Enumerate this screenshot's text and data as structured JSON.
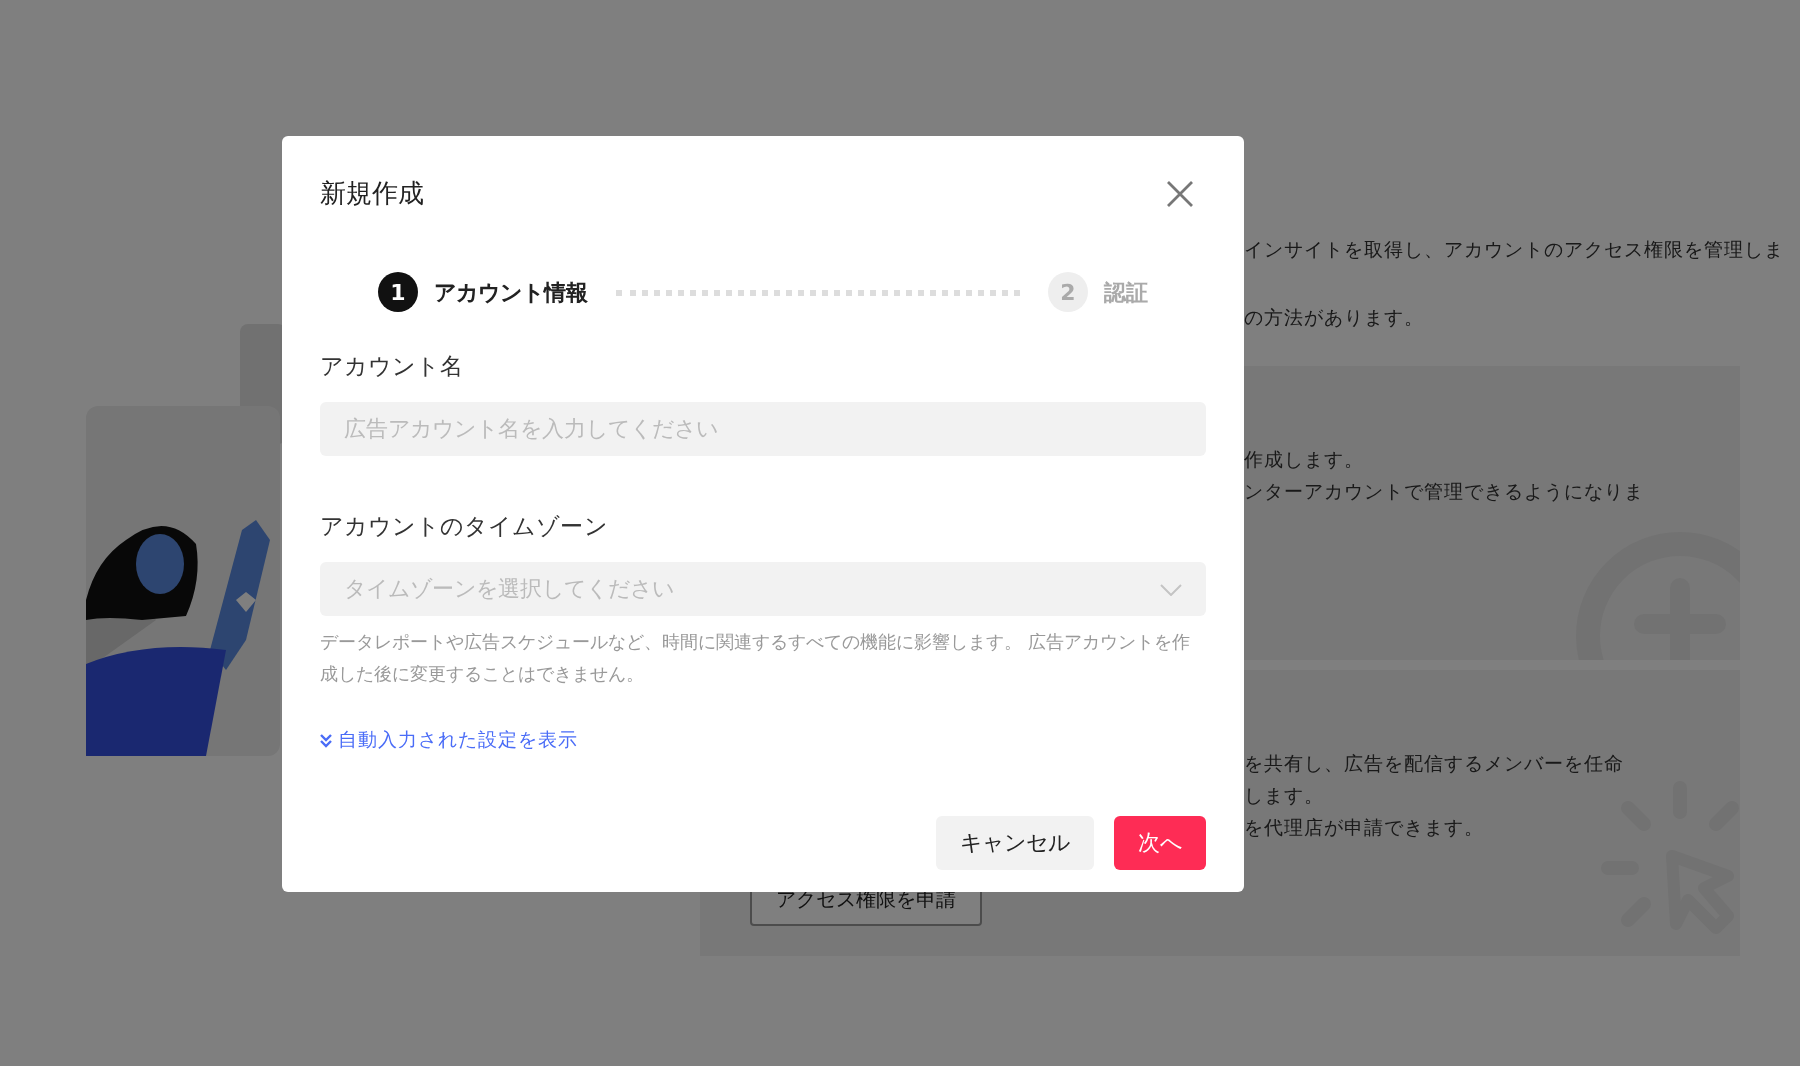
{
  "background": {
    "intro_lines": [
      "インサイトを取得し、アカウントのアクセス権限を管理しま",
      "の方法があります。"
    ],
    "cards": [
      {
        "lines": [
          "作成します。",
          "ンターアカウントで管理できるようになりま"
        ]
      },
      {
        "lines": [
          "を共有し、広告を配信するメンバーを任命",
          "します。",
          "を代理店が申請できます。"
        ],
        "button": "アクセス権限を申請"
      }
    ]
  },
  "dialog": {
    "title": "新規作成",
    "steps": [
      {
        "number": "1",
        "label": "アカウント情報",
        "selected": true
      },
      {
        "number": "2",
        "label": "認証",
        "selected": false
      }
    ],
    "fields": [
      {
        "kind": "text",
        "label": "アカウント名",
        "placeholder": "広告アカウント名を入力してください"
      },
      {
        "kind": "select",
        "label": "アカウントのタイムゾーン",
        "placeholder": "タイムゾーンを選択してください",
        "help": "データレポートや広告スケジュールなど、時間に関連するすべての機能に影響します。 広告アカウントを作成した後に変更することはできません。"
      }
    ],
    "link": "自動入力された設定を表示",
    "buttons": [
      {
        "kind": "secondary",
        "label": "キャンセル"
      },
      {
        "kind": "primary",
        "label": "次へ"
      }
    ]
  }
}
